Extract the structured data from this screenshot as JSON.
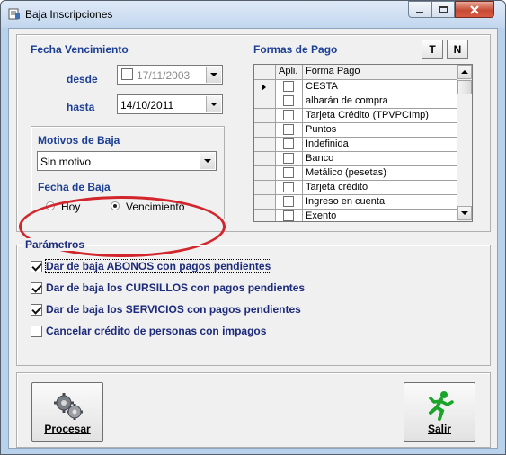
{
  "window": {
    "title": "Baja Inscripciones",
    "title_icon": "document-icon",
    "controls": [
      "minimize-icon",
      "maximize-icon",
      "close-icon"
    ]
  },
  "fecha_vencimiento": {
    "heading": "Fecha Vencimiento",
    "desde_label": "desde",
    "desde_value": "17/11/2003",
    "desde_checked": false,
    "hasta_label": "hasta",
    "hasta_value": "14/10/2011"
  },
  "motivos": {
    "heading": "Motivos de Baja",
    "selected": "Sin motivo"
  },
  "fecha_baja": {
    "heading": "Fecha de Baja",
    "options": [
      "Hoy",
      "Vencimiento"
    ],
    "selected": "Vencimiento"
  },
  "formas_pago": {
    "heading": "Formas de Pago",
    "btn_t": "T",
    "btn_n": "N",
    "columns": [
      "Apli.",
      "Forma Pago"
    ],
    "rows": [
      {
        "name": "CESTA",
        "checked": false,
        "current": true
      },
      {
        "name": "albarán de compra",
        "checked": false,
        "current": false
      },
      {
        "name": "Tarjeta Crédito (TPVPCImp)",
        "checked": false,
        "current": false
      },
      {
        "name": "Puntos",
        "checked": false,
        "current": false
      },
      {
        "name": "Indefinida",
        "checked": false,
        "current": false
      },
      {
        "name": "Banco",
        "checked": false,
        "current": false
      },
      {
        "name": "Metálico (pesetas)",
        "checked": false,
        "current": false
      },
      {
        "name": "Tarjeta crédito",
        "checked": false,
        "current": false
      },
      {
        "name": "Ingreso en cuenta",
        "checked": false,
        "current": false
      },
      {
        "name": "Exento",
        "checked": false,
        "current": false
      }
    ]
  },
  "parametros": {
    "heading": "Parámetros",
    "items": [
      {
        "label": "Dar de baja ABONOS con pagos pendientes",
        "checked": true
      },
      {
        "label": "Dar de baja los CURSILLOS con pagos pendientes",
        "checked": true
      },
      {
        "label": "Dar de baja los SERVICIOS con pagos pendientes",
        "checked": true
      },
      {
        "label": "Cancelar crédito de personas con impagos",
        "checked": false
      }
    ]
  },
  "buttons": {
    "procesar": {
      "label": "Procesar",
      "icon": "gears-icon"
    },
    "salir": {
      "label": "Salir",
      "icon": "running-man-icon"
    }
  },
  "annotation_color": "#d3262c"
}
